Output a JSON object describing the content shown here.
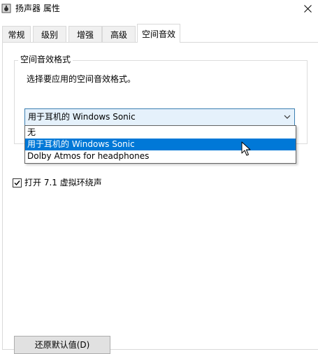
{
  "window": {
    "title": "扬声器 属性",
    "close_glyph": "✕"
  },
  "tabs": [
    {
      "label": "常规",
      "active": false
    },
    {
      "label": "级别",
      "active": false
    },
    {
      "label": "增强",
      "active": false
    },
    {
      "label": "高级",
      "active": false
    },
    {
      "label": "空间音效",
      "active": true
    }
  ],
  "spatial": {
    "group_title": "空间音效格式",
    "description": "选择要应用的空间音效格式。",
    "selected_value": "用于耳机的 Windows Sonic",
    "options": [
      {
        "label": "无",
        "highlighted": false
      },
      {
        "label": "用于耳机的 Windows Sonic",
        "highlighted": true
      },
      {
        "label": "Dolby Atmos for headphones",
        "highlighted": false
      }
    ],
    "virtual_surround": {
      "label": "打开 7.1 虚拟环绕声",
      "checked": true
    }
  },
  "footer": {
    "restore_defaults_label": "还原默认值(D)"
  },
  "colors": {
    "highlight": "#0078d7",
    "combo_background": "#e5f1fb",
    "combo_border": "#3c7fb1"
  }
}
